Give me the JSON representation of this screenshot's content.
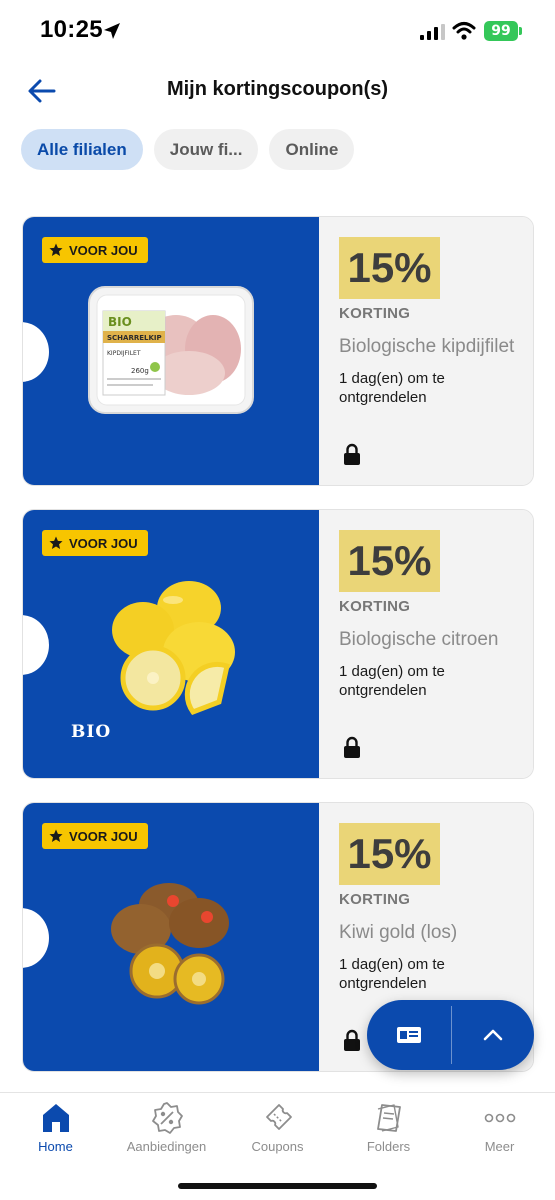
{
  "status_bar": {
    "time": "10:25",
    "battery": "99"
  },
  "header": {
    "title": "Mijn kortingscoupon(s)"
  },
  "filters": [
    {
      "label": "Alle filialen",
      "active": true
    },
    {
      "label": "Jouw fi...",
      "active": false
    },
    {
      "label": "Online",
      "active": false
    }
  ],
  "coupons": [
    {
      "badge": "VOOR JOU",
      "discount": "15%",
      "korting_label": "KORTING",
      "product": "Biologische kipdijfilet",
      "unlock_text": "1 dag(en) om te ontgrendelen",
      "locked": true,
      "image": "chicken-thigh-package"
    },
    {
      "badge": "VOOR JOU",
      "discount": "15%",
      "korting_label": "KORTING",
      "product": "Biologische citroen",
      "unlock_text": "1 dag(en) om te ontgrendelen",
      "locked": true,
      "image": "lemons",
      "image_tag": "BIO"
    },
    {
      "badge": "VOOR JOU",
      "discount": "15%",
      "korting_label": "KORTING",
      "product": "Kiwi gold (los)",
      "unlock_text": "1 dag(en) om te ontgrendelen",
      "locked": true,
      "image": "gold-kiwis"
    }
  ],
  "package_label": {
    "brand": "BIO",
    "type": "SCHARRELKIP",
    "product": "KIPDIJFILET",
    "weight": "260g"
  },
  "fab": {
    "card_icon": "loyalty-card-icon",
    "up_icon": "chevron-up-icon"
  },
  "bottom_nav": [
    {
      "label": "Home",
      "icon": "home-icon",
      "active": true
    },
    {
      "label": "Aanbiedingen",
      "icon": "discount-badge-icon",
      "active": false
    },
    {
      "label": "Coupons",
      "icon": "ticket-icon",
      "active": false
    },
    {
      "label": "Folders",
      "icon": "folder-pages-icon",
      "active": false
    },
    {
      "label": "Meer",
      "icon": "more-dots-icon",
      "active": false
    }
  ],
  "colors": {
    "brand_blue": "#0b4aae",
    "badge_yellow": "#f7c500",
    "discount_box": "#ead577",
    "chip_active_bg": "#cfe0f5"
  }
}
